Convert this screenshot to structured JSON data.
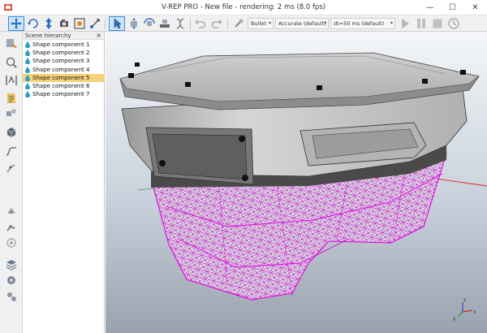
{
  "window": {
    "title": "V-REP PRO - New file - rendering: 2 ms (8.0 fps)",
    "minimize_glyph": "—",
    "maximize_glyph": "☐",
    "close_glyph": "✕"
  },
  "toolbar": {
    "left_icons": [
      "camera-pan-icon",
      "camera-rotate-icon",
      "camera-shift-icon",
      "camera-opening-icon",
      "fit-to-view-icon",
      "manipulation-icon",
      "click-selection-icon",
      "object-shift-icon",
      "object-rotate-icon",
      "assemble-icon",
      "transfer-dna-icon",
      "undo-icon",
      "redo-icon"
    ],
    "engine_select": "Bullet",
    "accuracy_select": "Accurate (default)",
    "timestep_select": "dt=50 ms (default)",
    "right_icons": [
      "play-icon",
      "pause-icon",
      "stop-icon",
      "real-time-icon"
    ]
  },
  "left_tools": [
    "scene-object-properties-icon",
    "calculation-modules-icon",
    "collections-icon",
    "scripts-icon",
    "shapes-icon",
    "paths-icon",
    "ik-icon",
    "dynamics-icon",
    "layers-icon",
    "model-browser-icon",
    "scene-hierarchy-icon"
  ],
  "hierarchy": {
    "title": "Scene hierarchy",
    "close_glyph": "×",
    "items": [
      {
        "label": "Shape component 1",
        "selected": false
      },
      {
        "label": "Shape component 2",
        "selected": false
      },
      {
        "label": "Shape component 3",
        "selected": false
      },
      {
        "label": "Shape component 4",
        "selected": false
      },
      {
        "label": "Shape component 5",
        "selected": true
      },
      {
        "label": "Shape component 6",
        "selected": false
      },
      {
        "label": "Shape component 7",
        "selected": false
      }
    ]
  },
  "viewport": {
    "wireframe_color": "#e000e0",
    "axis_labels": [
      "x",
      "y",
      "z"
    ]
  }
}
